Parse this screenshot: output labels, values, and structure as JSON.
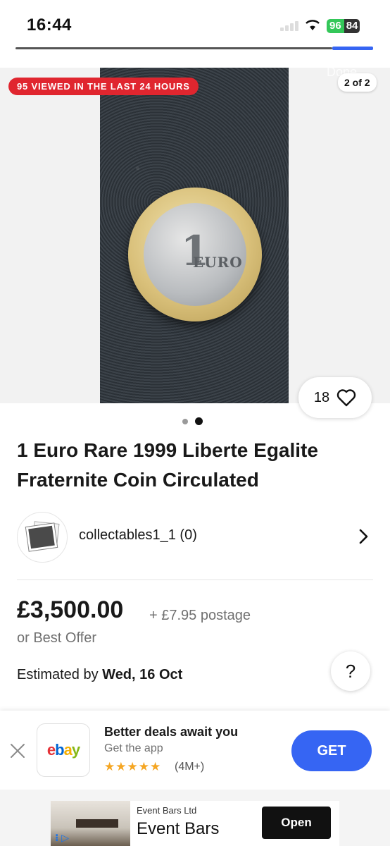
{
  "status_bar": {
    "time": "16:44",
    "battery_level": "96",
    "battery_secondary": "84"
  },
  "gallery": {
    "viewed_badge": "95 VIEWED IN THE LAST 24 HOURS",
    "photo_counter": "2 of 2",
    "done_label": "Done",
    "watch_count": "18",
    "dots_total": 2,
    "active_dot_index": 1
  },
  "listing": {
    "title": "1 Euro Rare 1999 Liberte Egalite Fraternite Coin Circulated",
    "seller": "collectables1_1 (0)",
    "price": "£3,500.00",
    "postage": "+ £7.95 postage",
    "best_offer": "or Best Offer",
    "estimated_prefix": "Estimated by",
    "estimated_date": "Wed, 16 Oct",
    "help_label": "?"
  },
  "app_banner": {
    "logo_letters": [
      "e",
      "b",
      "a",
      "y"
    ],
    "title": "Better deals await you",
    "subtitle": "Get the app",
    "stars": "★★★★★",
    "rating_count": "(4M+)",
    "get_label": "GET"
  },
  "ad": {
    "advertiser": "Event Bars Ltd",
    "headline": "Event Bars",
    "open_label": "Open"
  },
  "colors": {
    "accent_blue": "#3665f3",
    "badge_red": "#e0262f",
    "battery_green": "#34c759"
  }
}
